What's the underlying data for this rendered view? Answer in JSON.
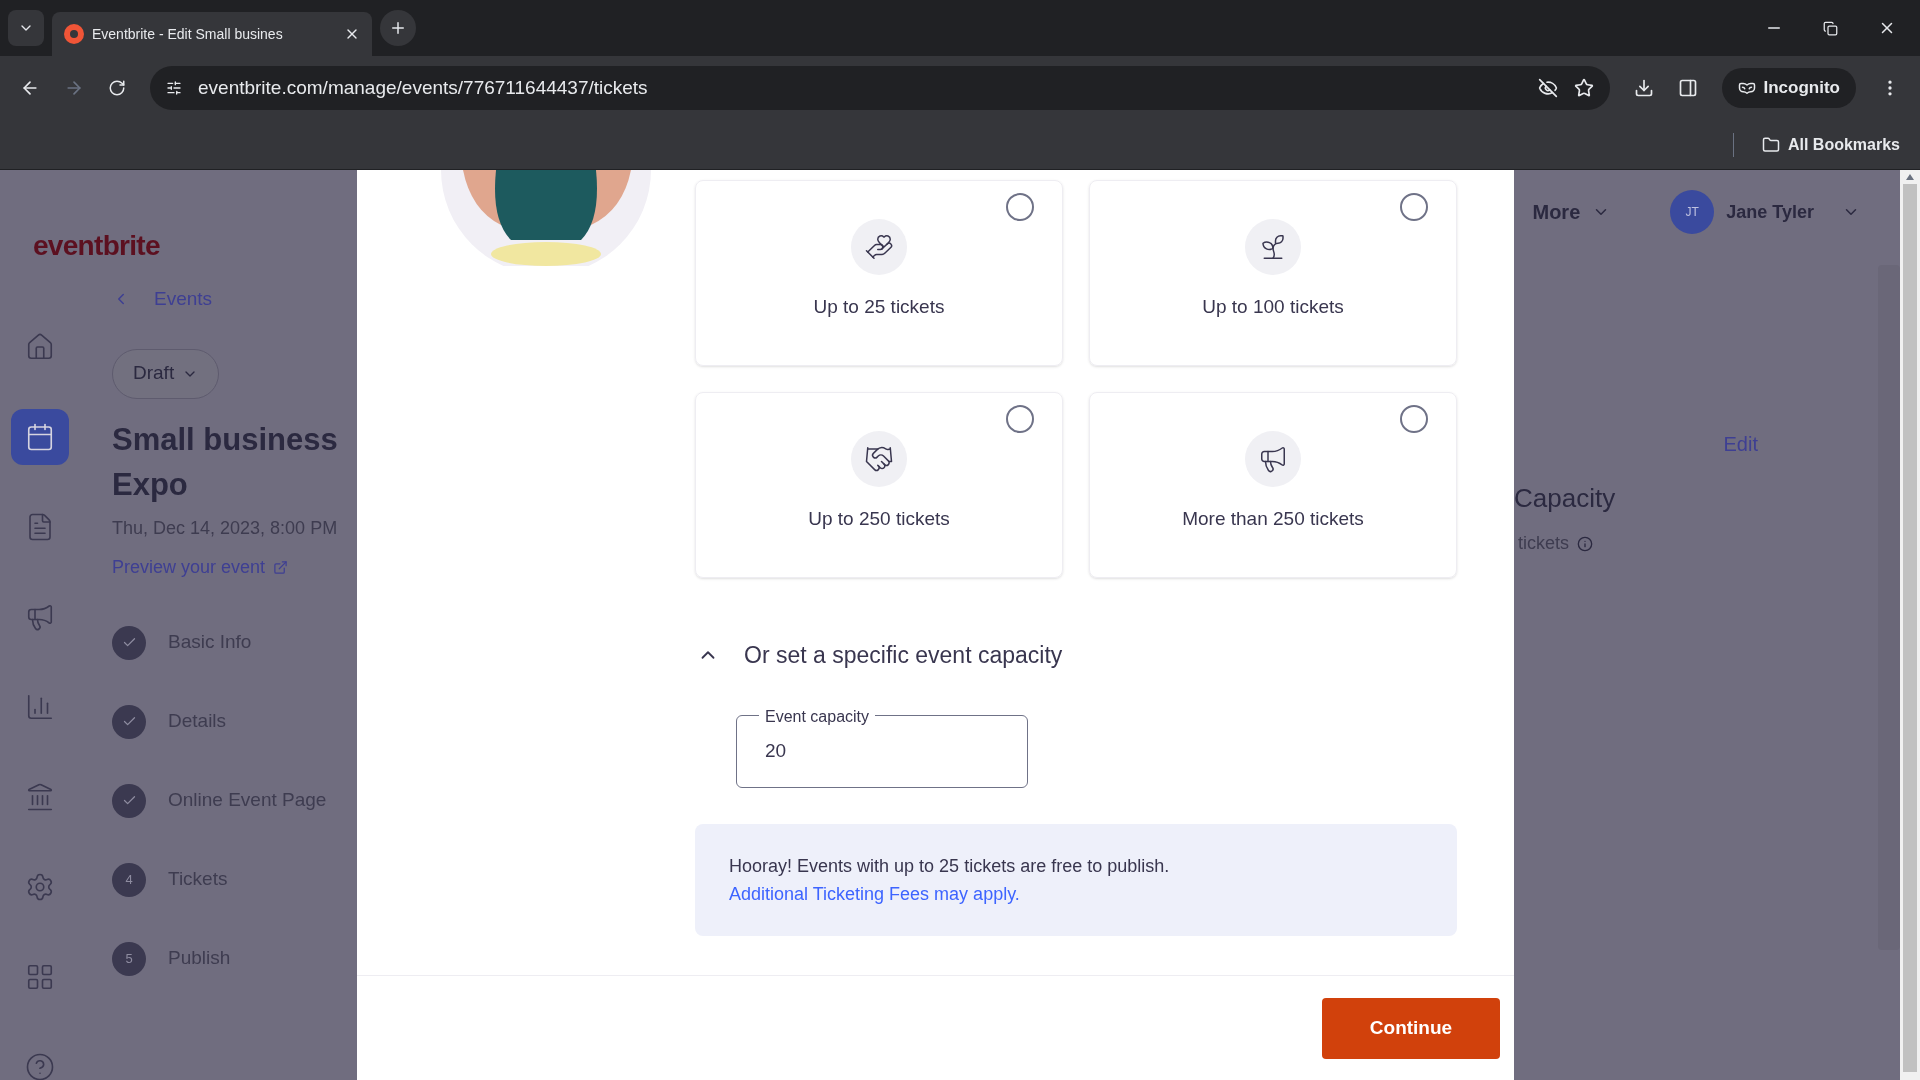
{
  "browser": {
    "tab_title": "Eventbrite - Edit Small busines",
    "url": "eventbrite.com/manage/events/776711644437/tickets",
    "profile": "Incognito",
    "bookmarks": "All Bookmarks"
  },
  "app": {
    "logo": "eventbrite",
    "nav": [
      {
        "kind": "home",
        "selected": false
      },
      {
        "kind": "calendar",
        "selected": true
      },
      {
        "kind": "list",
        "selected": false
      },
      {
        "kind": "megaphone",
        "selected": false
      },
      {
        "kind": "chart",
        "selected": false
      },
      {
        "kind": "bank",
        "selected": false
      },
      {
        "kind": "settings",
        "selected": false
      },
      {
        "kind": "apps",
        "selected": false
      },
      {
        "kind": "help",
        "selected": false
      }
    ],
    "back_link": "Events",
    "status": "Draft",
    "event_title": "Small business Expo",
    "event_date": "Thu, Dec 14, 2023, 8:00 PM",
    "preview_link": "Preview your event",
    "steps": [
      {
        "label": "Basic Info",
        "done": true
      },
      {
        "label": "Details",
        "done": true
      },
      {
        "label": "Online Event Page",
        "done": true
      },
      {
        "label": "Tickets",
        "done": false,
        "number": "4"
      },
      {
        "label": "Publish",
        "done": false,
        "number": "5"
      }
    ],
    "more": "More",
    "user": {
      "initials": "JT",
      "name": "Jane Tyler"
    },
    "edit": "Edit",
    "capacity_heading": "Capacity",
    "capacity_detail": "tickets"
  },
  "modal": {
    "options": [
      {
        "label": "Up to 25 tickets",
        "kind": "hand",
        "selected": false
      },
      {
        "label": "Up to 100 tickets",
        "kind": "sprout",
        "selected": false
      },
      {
        "label": "Up to 250 tickets",
        "kind": "handshake",
        "selected": false
      },
      {
        "label": "More than 250 tickets",
        "kind": "megaphone",
        "selected": false
      }
    ],
    "capacity_toggle": {
      "label": "Or set a specific event capacity",
      "expanded": true
    },
    "field": {
      "label": "Event capacity",
      "value": "20"
    },
    "notice": {
      "text": "Hooray! Events with up to 25 tickets are free to publish.",
      "link": "Additional Ticketing Fees may apply."
    },
    "button": "Continue"
  }
}
